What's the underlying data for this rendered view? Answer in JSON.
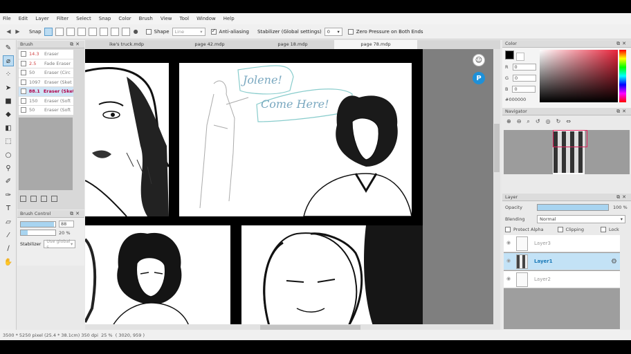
{
  "menu": [
    "File",
    "Edit",
    "Layer",
    "Filter",
    "Select",
    "Snap",
    "Color",
    "Brush",
    "View",
    "Tool",
    "Window",
    "Help"
  ],
  "toolbar": {
    "snap_label": "Snap",
    "shape_label": "Shape",
    "shape_value": "Line",
    "antialias_label": "Anti-aliasing",
    "stabilizer_label": "Stabilizer (Global settings)",
    "stabilizer_value": "0",
    "zero_pressure_label": "Zero Pressure on Both Ends"
  },
  "brush_panel": {
    "title": "Brush",
    "items": [
      {
        "size": "14.3",
        "name": "Eraser",
        "red": true
      },
      {
        "size": "2.5",
        "name": "Fade Eraser",
        "red": true
      },
      {
        "size": "50",
        "name": "Eraser (Circ"
      },
      {
        "size": "1097",
        "name": "Eraser (Sket"
      },
      {
        "size": "88.1",
        "name": "Eraser (Sket",
        "selected": true
      },
      {
        "size": "150",
        "name": "Eraser (Soft"
      },
      {
        "size": "50",
        "name": "Eraser (Soft"
      }
    ]
  },
  "brush_control": {
    "title": "Brush Control",
    "size_value": "88",
    "size_fill": 0.95,
    "opacity_value": "20 %",
    "opacity_fill": 0.2,
    "stabilizer_label": "Stabilizer",
    "stabilizer_value": "Use global s"
  },
  "tabs": [
    "ike's truck.mdp",
    "page 42.mdp",
    "page 18.mdp",
    "page 78.mdp"
  ],
  "comic_text": {
    "speech_line1": "Jolene!",
    "speech_line2": "Come Here!"
  },
  "color_panel": {
    "title": "Color",
    "r_label": "R",
    "r_value": "0",
    "g_label": "G",
    "g_value": "0",
    "b_label": "B",
    "b_value": "0",
    "hex": "#000000",
    "accent": "#e8243b"
  },
  "navigator": {
    "title": "Navigator"
  },
  "layer_panel": {
    "title": "Layer",
    "opacity_label": "Opacity",
    "opacity_value": "100 %",
    "blending_label": "Blending",
    "blending_value": "Normal",
    "protect_alpha": "Protect Alpha",
    "clipping": "Clipping",
    "lock": "Lock",
    "layers": [
      {
        "name": "Layer3"
      },
      {
        "name": "Layer1",
        "selected": true
      },
      {
        "name": "Layer2"
      }
    ]
  },
  "status": {
    "size": "3500 * 5250 pixel",
    "physical": "(25.4 * 38.1cm)",
    "dpi": "350 dpi",
    "zoom": "25 %",
    "coords": "( 3020, 959 )"
  }
}
